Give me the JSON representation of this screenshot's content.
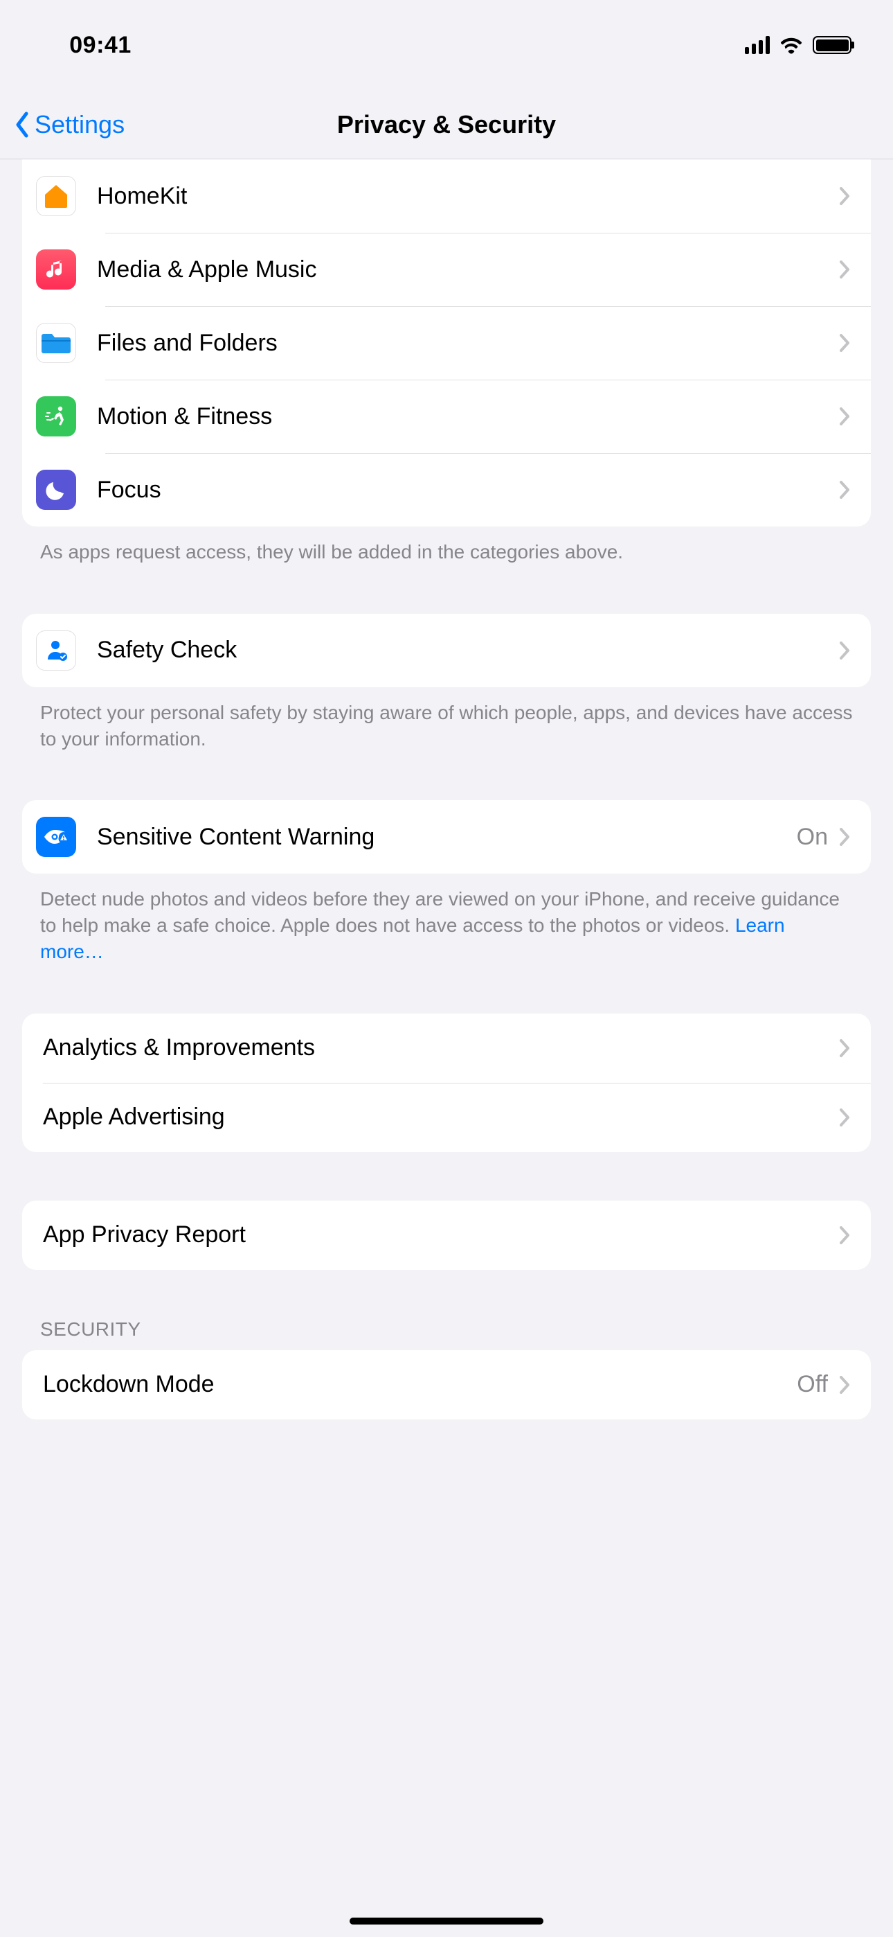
{
  "status": {
    "time": "09:41"
  },
  "nav": {
    "back_label": "Settings",
    "title": "Privacy & Security"
  },
  "group1": {
    "items": [
      {
        "label": "HomeKit"
      },
      {
        "label": "Media & Apple Music"
      },
      {
        "label": "Files and Folders"
      },
      {
        "label": "Motion & Fitness"
      },
      {
        "label": "Focus"
      }
    ],
    "footer": "As apps request access, they will be added in the categories above."
  },
  "safety": {
    "label": "Safety Check",
    "footer": "Protect your personal safety by staying aware of which people, apps, and devices have access to your information."
  },
  "sensitive": {
    "label": "Sensitive Content Warning",
    "value": "On",
    "footer": "Detect nude photos and videos before they are viewed on your iPhone, and receive guidance to help make a safe choice. Apple does not have access to the photos or videos. ",
    "learn_more": "Learn more…"
  },
  "analytics": {
    "items": [
      {
        "label": "Analytics & Improvements"
      },
      {
        "label": "Apple Advertising"
      }
    ]
  },
  "app_privacy": {
    "label": "App Privacy Report"
  },
  "security": {
    "header": "SECURITY",
    "lockdown_label": "Lockdown Mode",
    "lockdown_value": "Off"
  }
}
